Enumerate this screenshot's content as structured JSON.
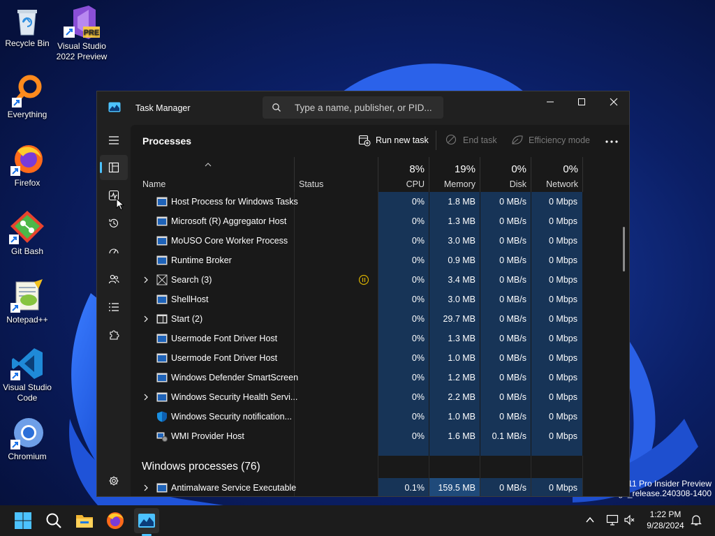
{
  "desktop": {
    "icons": [
      {
        "label": "Recycle Bin"
      },
      {
        "label": "Visual Studio 2022 Preview"
      },
      {
        "label": "Everything"
      },
      {
        "label": "Firefox"
      },
      {
        "label": "Git Bash"
      },
      {
        "label": "Notepad++"
      },
      {
        "label": "Visual Studio Code"
      },
      {
        "label": "Chromium"
      }
    ],
    "vs_badge": "PRE",
    "watermark_line1": "11 Pro Insider Preview",
    "watermark_line2": "ge_release.240308-1400"
  },
  "window": {
    "title": "Task Manager",
    "search_placeholder": "Type a name, publisher, or PID..."
  },
  "toolbar": {
    "page_title": "Processes",
    "run_new_task": "Run new task",
    "end_task": "End task",
    "efficiency_mode": "Efficiency mode"
  },
  "columns": {
    "name": "Name",
    "status": "Status",
    "cpu_pct": "8%",
    "cpu": "CPU",
    "mem_pct": "19%",
    "memory": "Memory",
    "disk_pct": "0%",
    "disk": "Disk",
    "net_pct": "0%",
    "network": "Network"
  },
  "processes": [
    {
      "name": "Host Process for Windows Tasks",
      "expand": false,
      "icon": "app",
      "status": "",
      "cpu": "0%",
      "memory": "1.8 MB",
      "disk": "0 MB/s",
      "network": "0 Mbps"
    },
    {
      "name": "Microsoft (R) Aggregator Host",
      "expand": false,
      "icon": "app",
      "status": "",
      "cpu": "0%",
      "memory": "1.3 MB",
      "disk": "0 MB/s",
      "network": "0 Mbps"
    },
    {
      "name": "MoUSO Core Worker Process",
      "expand": false,
      "icon": "app",
      "status": "",
      "cpu": "0%",
      "memory": "3.0 MB",
      "disk": "0 MB/s",
      "network": "0 Mbps"
    },
    {
      "name": "Runtime Broker",
      "expand": false,
      "icon": "app",
      "status": "",
      "cpu": "0%",
      "memory": "0.9 MB",
      "disk": "0 MB/s",
      "network": "0 Mbps"
    },
    {
      "name": "Search (3)",
      "expand": true,
      "icon": "search",
      "status": "paused",
      "cpu": "0%",
      "memory": "3.4 MB",
      "disk": "0 MB/s",
      "network": "0 Mbps"
    },
    {
      "name": "ShellHost",
      "expand": false,
      "icon": "app",
      "status": "",
      "cpu": "0%",
      "memory": "3.0 MB",
      "disk": "0 MB/s",
      "network": "0 Mbps"
    },
    {
      "name": "Start (2)",
      "expand": true,
      "icon": "start",
      "status": "",
      "cpu": "0%",
      "memory": "29.7 MB",
      "disk": "0 MB/s",
      "network": "0 Mbps"
    },
    {
      "name": "Usermode Font Driver Host",
      "expand": false,
      "icon": "app",
      "status": "",
      "cpu": "0%",
      "memory": "1.3 MB",
      "disk": "0 MB/s",
      "network": "0 Mbps"
    },
    {
      "name": "Usermode Font Driver Host",
      "expand": false,
      "icon": "app",
      "status": "",
      "cpu": "0%",
      "memory": "1.0 MB",
      "disk": "0 MB/s",
      "network": "0 Mbps"
    },
    {
      "name": "Windows Defender SmartScreen",
      "expand": false,
      "icon": "app",
      "status": "",
      "cpu": "0%",
      "memory": "1.2 MB",
      "disk": "0 MB/s",
      "network": "0 Mbps"
    },
    {
      "name": "Windows Security Health Servi...",
      "expand": true,
      "icon": "app",
      "status": "",
      "cpu": "0%",
      "memory": "2.2 MB",
      "disk": "0 MB/s",
      "network": "0 Mbps"
    },
    {
      "name": "Windows Security notification...",
      "expand": false,
      "icon": "shield",
      "status": "",
      "cpu": "0%",
      "memory": "1.0 MB",
      "disk": "0 MB/s",
      "network": "0 Mbps"
    },
    {
      "name": "WMI Provider Host",
      "expand": false,
      "icon": "wmi",
      "status": "",
      "cpu": "0%",
      "memory": "1.6 MB",
      "disk": "0.1 MB/s",
      "network": "0 Mbps"
    }
  ],
  "group": {
    "label": "Windows processes (76)"
  },
  "last_row": {
    "name": "Antimalware Service Executable",
    "cpu": "0.1%",
    "memory": "159.5 MB",
    "disk": "0 MB/s",
    "network": "0 Mbps"
  },
  "taskbar": {
    "time": "1:22 PM",
    "date": "9/28/2024"
  },
  "colors": {
    "accent": "#4cc2ff",
    "heat_low": "#173457",
    "heat_mid": "#1f4a7a",
    "paused": "#d8b000"
  }
}
